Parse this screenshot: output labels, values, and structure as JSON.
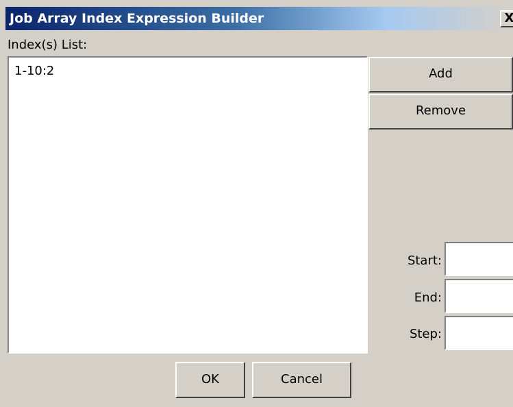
{
  "window": {
    "title": "Job Array Index Expression Builder",
    "close_glyph": "X",
    "close_icon": "close-icon"
  },
  "index_list": {
    "label": "Index(s) List:",
    "items": [
      "1-10:2"
    ]
  },
  "buttons": {
    "add": "Add",
    "remove": "Remove",
    "ok": "OK",
    "cancel": "Cancel"
  },
  "fields": {
    "start": {
      "label": "Start:",
      "value": ""
    },
    "end": {
      "label": "End:",
      "value": ""
    },
    "step": {
      "label": "Step:",
      "value": ""
    }
  },
  "colors": {
    "title_bar_start": "#0a246a",
    "title_bar_end": "#a6caf0",
    "window_bg": "#d4d0c8"
  }
}
